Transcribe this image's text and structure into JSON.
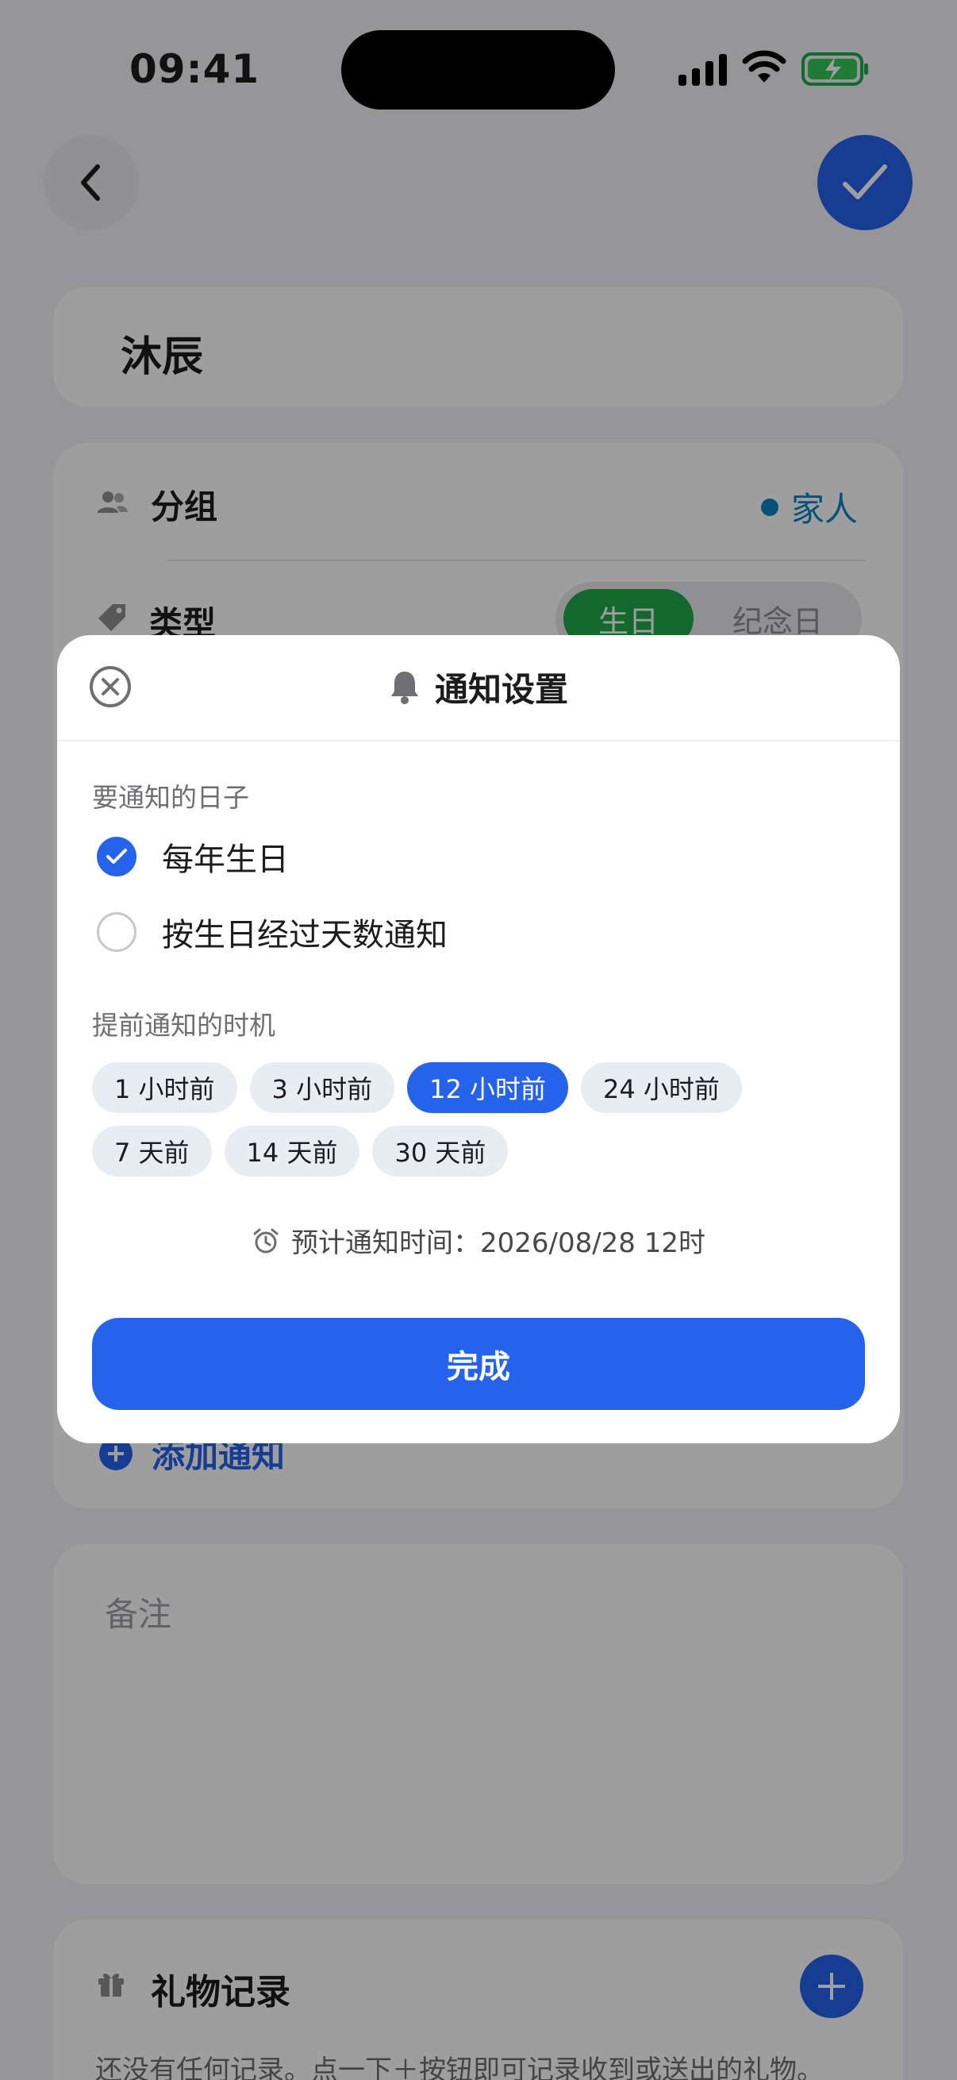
{
  "status_bar": {
    "time": "09:41"
  },
  "form": {
    "name": "沐辰",
    "group_label": "分组",
    "group_value": "家人",
    "group_color": "#0a84c6",
    "type_label": "类型",
    "type_options": [
      "生日",
      "纪念日"
    ],
    "type_selected": "生日",
    "add_notification": "添加通知",
    "note_placeholder": "备注",
    "gift_title": "礼物记录",
    "gift_empty": "还没有任何记录。点一下＋按钮即可记录收到或送出的礼物。"
  },
  "modal": {
    "title": "通知设置",
    "section_days": "要通知的日子",
    "options": [
      {
        "label": "每年生日",
        "checked": true
      },
      {
        "label": "按生日经过天数通知",
        "checked": false
      }
    ],
    "section_timing": "提前通知的时机",
    "chips": [
      {
        "label": "1 小时前",
        "selected": false
      },
      {
        "label": "3 小时前",
        "selected": false
      },
      {
        "label": "12 小时前",
        "selected": true
      },
      {
        "label": "24 小时前",
        "selected": false
      },
      {
        "label": "7 天前",
        "selected": false
      },
      {
        "label": "14 天前",
        "selected": false
      },
      {
        "label": "30 天前",
        "selected": false
      }
    ],
    "eta_text": "预计通知时间：2026/08/28 12时",
    "done_label": "完成"
  },
  "colors": {
    "accent": "#2563eb",
    "birthday_green": "#1ea84a"
  },
  "icons": [
    "back-chevron-icon",
    "checkmark-icon",
    "people-icon",
    "tag-icon",
    "close-circle-icon",
    "bell-icon",
    "alarm-clock-icon",
    "plus-icon",
    "gift-icon"
  ]
}
